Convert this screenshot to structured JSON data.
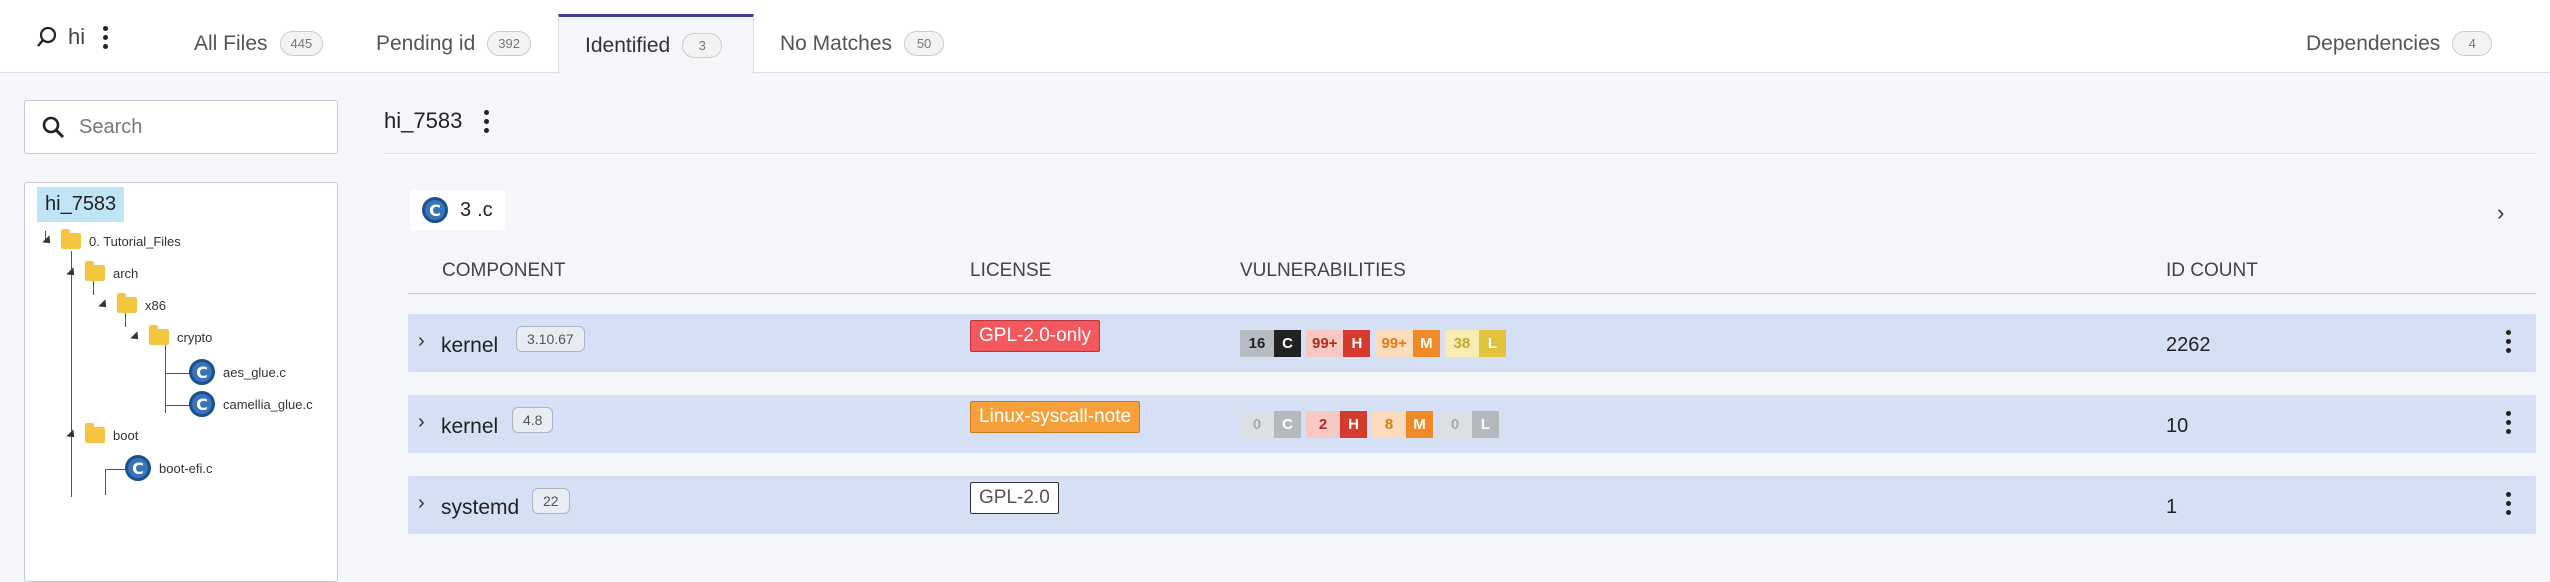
{
  "header": {
    "project": "hi",
    "tabs": [
      {
        "label": "All Files",
        "count": "445"
      },
      {
        "label": "Pending id",
        "count": "392"
      },
      {
        "label": "Identified",
        "count": "3"
      },
      {
        "label": "No Matches",
        "count": "50"
      },
      {
        "label": "Dependencies",
        "count": "4"
      }
    ]
  },
  "sidebar": {
    "search_placeholder": "Search",
    "tree": {
      "root": "hi_7583",
      "folder_tutorial": "0. Tutorial_Files",
      "folder_arch": "arch",
      "folder_x86": "x86",
      "folder_crypto": "crypto",
      "file_aes": "aes_glue.c",
      "file_camellia": "camellia_glue.c",
      "folder_boot": "boot",
      "file_bootefi": "boot-efi.c"
    }
  },
  "main": {
    "title": "hi_7583",
    "group": {
      "count": "3",
      "ext": ".c"
    },
    "columns": {
      "component": "COMPONENT",
      "license": "LICENSE",
      "vulnerabilities": "VULNERABILITIES",
      "id_count": "ID COUNT"
    },
    "rows": [
      {
        "component": "kernel",
        "version": "3.10.67",
        "license": "GPL-2.0-only",
        "id_count": "2262",
        "vulns": {
          "c": "16",
          "h": "99+",
          "m": "99+",
          "l": "38"
        }
      },
      {
        "component": "kernel",
        "version": "4.8",
        "license": "Linux-syscall-note",
        "id_count": "10",
        "vulns": {
          "c": "0",
          "h": "2",
          "m": "8",
          "l": "0"
        }
      },
      {
        "component": "systemd",
        "version": "22",
        "license": "GPL-2.0",
        "id_count": "1"
      }
    ]
  },
  "severity_letters": {
    "c": "C",
    "h": "H",
    "m": "M",
    "l": "L"
  },
  "colors": {
    "accent": "#3d3d9e",
    "row_bg": "#d5e0f4",
    "license_gpl_only": "#f3585e",
    "license_syscall": "#f5a03a",
    "critical": "#222222",
    "high": "#d33b2c",
    "medium": "#ef8a26",
    "low": "#e1c43c"
  }
}
